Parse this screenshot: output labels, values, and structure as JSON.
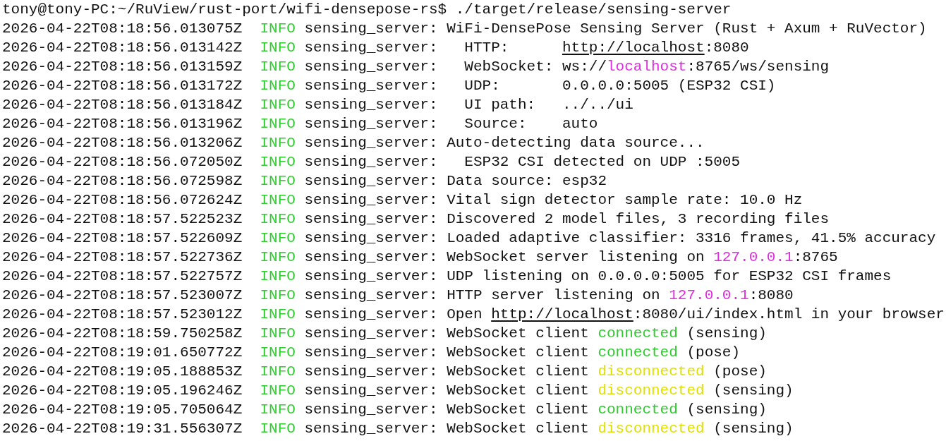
{
  "prompt": {
    "user_path": "tony@tony-PC:~/RuView/rust-port/wifi-densepose-rs$",
    "command": "./target/release/sensing-server"
  },
  "log_lines": [
    {
      "timestamp": "2026-04-22T08:18:56.013075Z",
      "level": "INFO",
      "source": "sensing_server:",
      "segments": [
        {
          "kind": "plain",
          "text": "WiFi-DensePose Sensing Server (Rust + Axum + RuVector)"
        }
      ]
    },
    {
      "timestamp": "2026-04-22T08:18:56.013142Z",
      "level": "INFO",
      "source": "sensing_server:",
      "segments": [
        {
          "kind": "plain",
          "text": "  HTTP:      "
        },
        {
          "kind": "link",
          "text": "http://localhost"
        },
        {
          "kind": "plain",
          "text": ":8080"
        }
      ]
    },
    {
      "timestamp": "2026-04-22T08:18:56.013159Z",
      "level": "INFO",
      "source": "sensing_server:",
      "segments": [
        {
          "kind": "plain",
          "text": "  WebSocket: ws://"
        },
        {
          "kind": "host",
          "text": "localhost"
        },
        {
          "kind": "plain",
          "text": ":8765/ws/sensing"
        }
      ]
    },
    {
      "timestamp": "2026-04-22T08:18:56.013172Z",
      "level": "INFO",
      "source": "sensing_server:",
      "segments": [
        {
          "kind": "plain",
          "text": "  UDP:       0.0.0.0:5005 (ESP32 CSI)"
        }
      ]
    },
    {
      "timestamp": "2026-04-22T08:18:56.013184Z",
      "level": "INFO",
      "source": "sensing_server:",
      "segments": [
        {
          "kind": "plain",
          "text": "  UI path:   ../../ui"
        }
      ]
    },
    {
      "timestamp": "2026-04-22T08:18:56.013196Z",
      "level": "INFO",
      "source": "sensing_server:",
      "segments": [
        {
          "kind": "plain",
          "text": "  Source:    auto"
        }
      ]
    },
    {
      "timestamp": "2026-04-22T08:18:56.013206Z",
      "level": "INFO",
      "source": "sensing_server:",
      "segments": [
        {
          "kind": "plain",
          "text": "Auto-detecting data source..."
        }
      ]
    },
    {
      "timestamp": "2026-04-22T08:18:56.072050Z",
      "level": "INFO",
      "source": "sensing_server:",
      "segments": [
        {
          "kind": "plain",
          "text": "  ESP32 CSI detected on UDP :5005"
        }
      ]
    },
    {
      "timestamp": "2026-04-22T08:18:56.072598Z",
      "level": "INFO",
      "source": "sensing_server:",
      "segments": [
        {
          "kind": "plain",
          "text": "Data source: esp32"
        }
      ]
    },
    {
      "timestamp": "2026-04-22T08:18:56.072624Z",
      "level": "INFO",
      "source": "sensing_server:",
      "segments": [
        {
          "kind": "plain",
          "text": "Vital sign detector sample rate: 10.0 Hz"
        }
      ]
    },
    {
      "timestamp": "2026-04-22T08:18:57.522523Z",
      "level": "INFO",
      "source": "sensing_server:",
      "segments": [
        {
          "kind": "plain",
          "text": "Discovered 2 model files, 3 recording files"
        }
      ]
    },
    {
      "timestamp": "2026-04-22T08:18:57.522609Z",
      "level": "INFO",
      "source": "sensing_server:",
      "segments": [
        {
          "kind": "plain",
          "text": "Loaded adaptive classifier: 3316 frames, 41.5% accuracy"
        }
      ]
    },
    {
      "timestamp": "2026-04-22T08:18:57.522736Z",
      "level": "INFO",
      "source": "sensing_server:",
      "segments": [
        {
          "kind": "plain",
          "text": "WebSocket server listening on "
        },
        {
          "kind": "host",
          "text": "127.0.0.1"
        },
        {
          "kind": "plain",
          "text": ":8765"
        }
      ]
    },
    {
      "timestamp": "2026-04-22T08:18:57.522757Z",
      "level": "INFO",
      "source": "sensing_server:",
      "segments": [
        {
          "kind": "plain",
          "text": "UDP listening on 0.0.0.0:5005 for ESP32 CSI frames"
        }
      ]
    },
    {
      "timestamp": "2026-04-22T08:18:57.523007Z",
      "level": "INFO",
      "source": "sensing_server:",
      "segments": [
        {
          "kind": "plain",
          "text": "HTTP server listening on "
        },
        {
          "kind": "host",
          "text": "127.0.0.1"
        },
        {
          "kind": "plain",
          "text": ":8080"
        }
      ]
    },
    {
      "timestamp": "2026-04-22T08:18:57.523012Z",
      "level": "INFO",
      "source": "sensing_server:",
      "segments": [
        {
          "kind": "plain",
          "text": "Open "
        },
        {
          "kind": "link",
          "text": "http://localhost"
        },
        {
          "kind": "plain",
          "text": ":8080/ui/index.html in your browser"
        }
      ]
    },
    {
      "timestamp": "2026-04-22T08:18:59.750258Z",
      "level": "INFO",
      "source": "sensing_server:",
      "segments": [
        {
          "kind": "plain",
          "text": "WebSocket client "
        },
        {
          "kind": "ok",
          "text": "connected"
        },
        {
          "kind": "plain",
          "text": " (sensing)"
        }
      ]
    },
    {
      "timestamp": "2026-04-22T08:19:01.650772Z",
      "level": "INFO",
      "source": "sensing_server:",
      "segments": [
        {
          "kind": "plain",
          "text": "WebSocket client "
        },
        {
          "kind": "ok",
          "text": "connected"
        },
        {
          "kind": "plain",
          "text": " (pose)"
        }
      ]
    },
    {
      "timestamp": "2026-04-22T08:19:05.188853Z",
      "level": "INFO",
      "source": "sensing_server:",
      "segments": [
        {
          "kind": "plain",
          "text": "WebSocket client "
        },
        {
          "kind": "warn",
          "text": "disconnected"
        },
        {
          "kind": "plain",
          "text": " (pose)"
        }
      ]
    },
    {
      "timestamp": "2026-04-22T08:19:05.196246Z",
      "level": "INFO",
      "source": "sensing_server:",
      "segments": [
        {
          "kind": "plain",
          "text": "WebSocket client "
        },
        {
          "kind": "warn",
          "text": "disconnected"
        },
        {
          "kind": "plain",
          "text": " (sensing)"
        }
      ]
    },
    {
      "timestamp": "2026-04-22T08:19:05.705064Z",
      "level": "INFO",
      "source": "sensing_server:",
      "segments": [
        {
          "kind": "plain",
          "text": "WebSocket client "
        },
        {
          "kind": "ok",
          "text": "connected"
        },
        {
          "kind": "plain",
          "text": " (sensing)"
        }
      ]
    },
    {
      "timestamp": "2026-04-22T08:19:31.556307Z",
      "level": "INFO",
      "source": "sensing_server:",
      "segments": [
        {
          "kind": "plain",
          "text": "WebSocket client "
        },
        {
          "kind": "warn",
          "text": "disconnected"
        },
        {
          "kind": "plain",
          "text": " (sensing)"
        }
      ]
    }
  ]
}
